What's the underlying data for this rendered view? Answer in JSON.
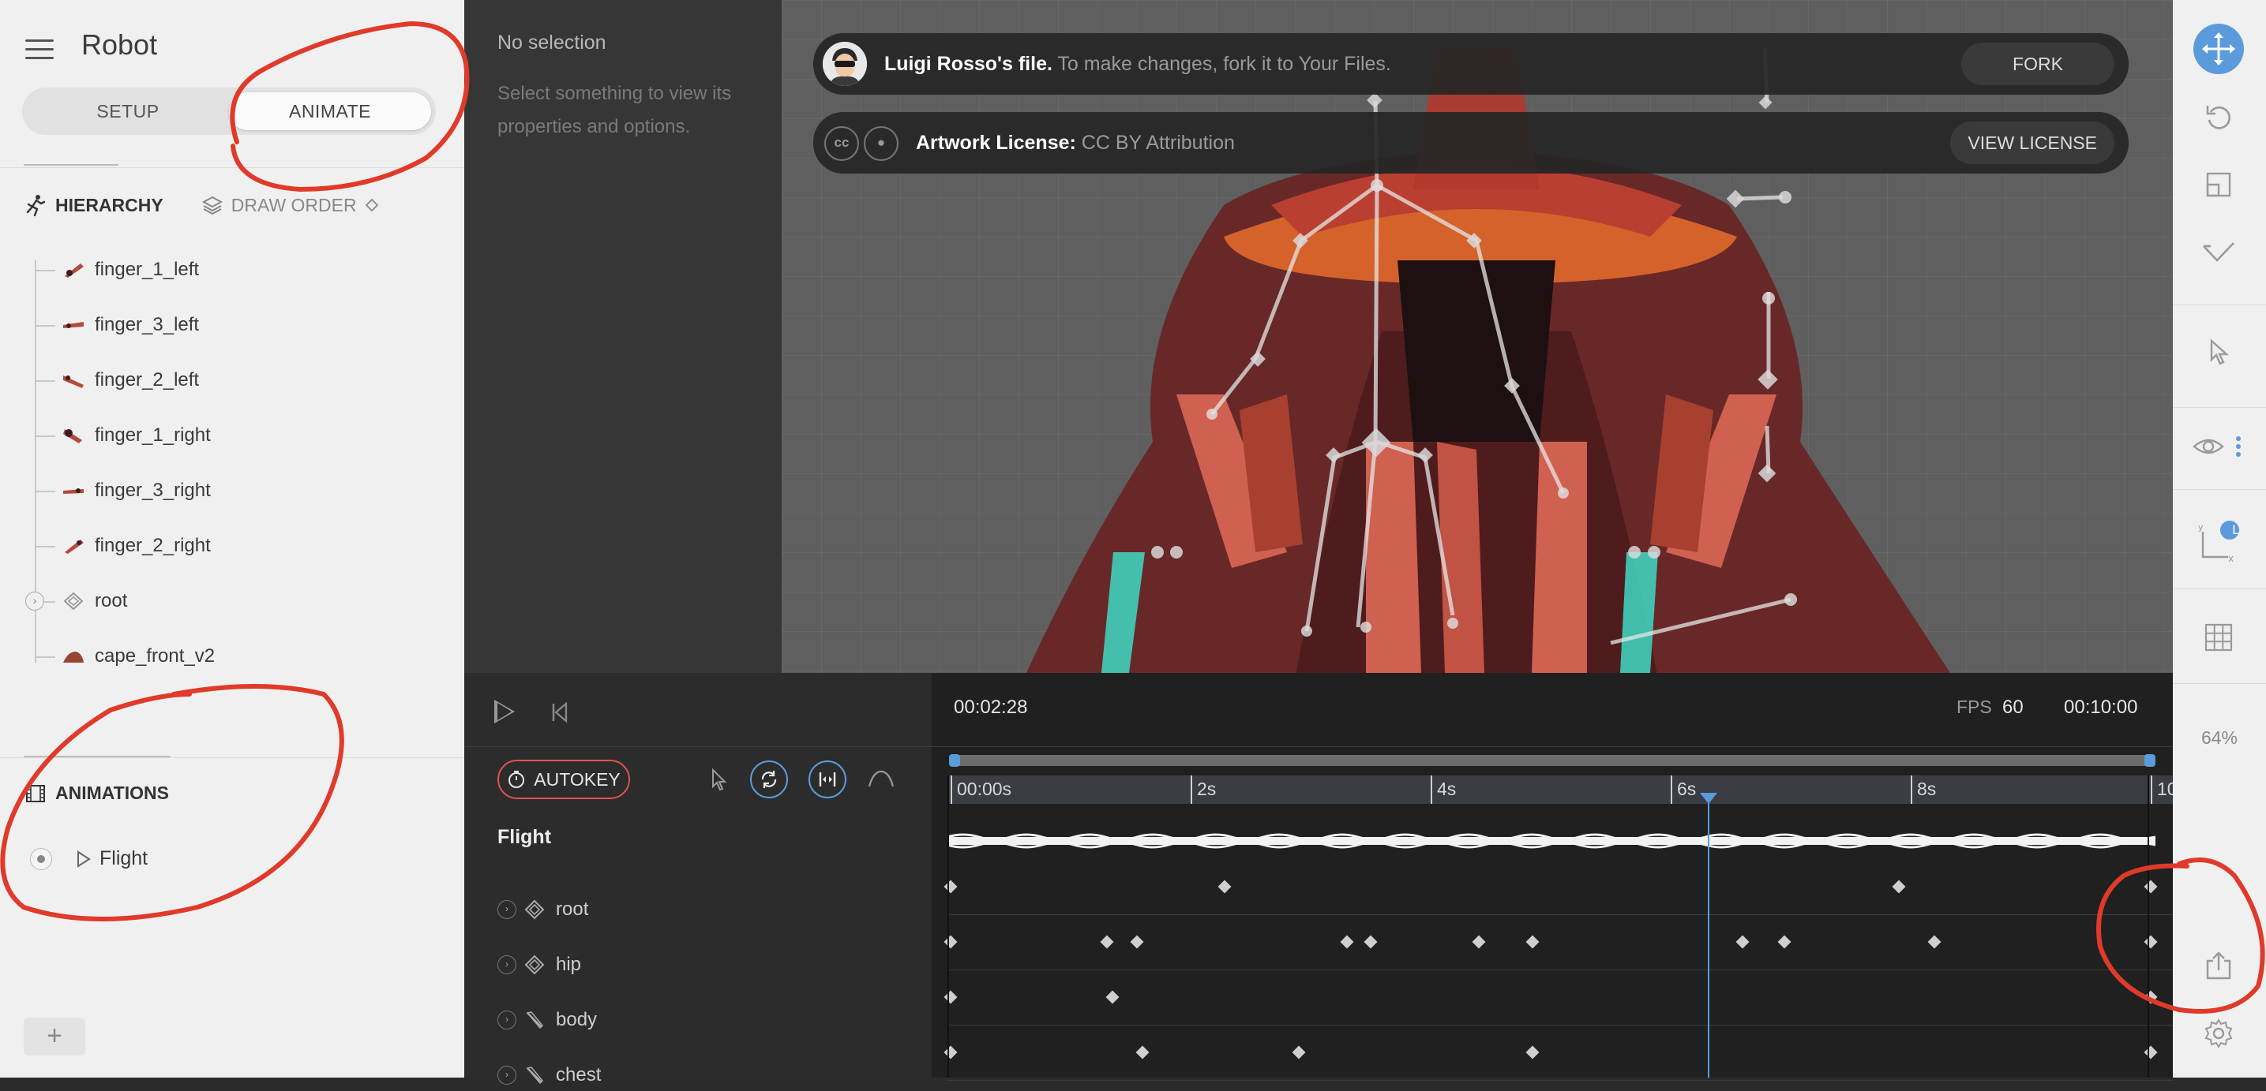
{
  "app": {
    "title": "Robot",
    "modes": {
      "setup": "SETUP",
      "animate": "ANIMATE",
      "active": "ANIMATE"
    }
  },
  "hierarchy": {
    "tab_hierarchy": "HIERARCHY",
    "tab_draw_order": "DRAW ORDER",
    "items": [
      {
        "label": "finger_1_left",
        "icon": "image-thumb-icon"
      },
      {
        "label": "finger_3_left",
        "icon": "image-thumb-icon"
      },
      {
        "label": "finger_2_left",
        "icon": "image-thumb-icon"
      },
      {
        "label": "finger_1_right",
        "icon": "image-thumb-icon"
      },
      {
        "label": "finger_3_right",
        "icon": "image-thumb-icon"
      },
      {
        "label": "finger_2_right",
        "icon": "image-thumb-icon"
      },
      {
        "label": "root",
        "icon": "bone-root-icon"
      },
      {
        "label": "cape_front_v2",
        "icon": "image-thumb-icon"
      }
    ]
  },
  "animations": {
    "header": "ANIMATIONS",
    "items": [
      {
        "label": "Flight"
      }
    ]
  },
  "properties": {
    "title": "No selection",
    "description": "Select something to view its properties and options."
  },
  "notices": {
    "fork": {
      "owner": "Luigi Rosso's file.",
      "text": "To make changes, fork it to Your Files.",
      "button": "FORK"
    },
    "license": {
      "label": "Artwork License:",
      "value": "CC BY Attribution",
      "button": "VIEW LICENSE"
    }
  },
  "timeline": {
    "current_time": "00:02:28",
    "fps_label": "FPS",
    "fps": "60",
    "duration": "00:10:00",
    "autokey": "AUTOKEY",
    "animation_name": "Flight",
    "ruler": [
      "00:00s",
      "2s",
      "4s",
      "6s",
      "8s",
      "10"
    ],
    "tracks": [
      {
        "label": "root",
        "icon": "bone-root-icon",
        "keys_s": [
          0,
          2.28,
          7.9,
          10
        ]
      },
      {
        "label": "hip",
        "icon": "bone-root-icon",
        "keys_s": [
          0,
          1.3,
          1.55,
          3.3,
          3.5,
          4.4,
          4.85,
          6.6,
          6.95,
          8.2,
          10
        ]
      },
      {
        "label": "body",
        "icon": "bone-icon",
        "keys_s": [
          0,
          1.35,
          10
        ]
      },
      {
        "label": "chest",
        "icon": "bone-icon",
        "keys_s": [
          0,
          1.6,
          2.9,
          4.85,
          10
        ]
      }
    ]
  },
  "toolbar": {
    "zoom": "64%",
    "badge": "L",
    "tools": [
      "move-icon",
      "rotate-icon",
      "scale-icon",
      "check-icon",
      "select-cursor-icon",
      "eye-icon",
      "axis-icon",
      "grid-icon",
      "export-icon",
      "gear-icon"
    ]
  },
  "colors": {
    "accent": "#5b9bdb",
    "annotation": "#e03a2a",
    "panel_light": "#f0f0f0",
    "panel_dark": "#2b2b2b"
  }
}
